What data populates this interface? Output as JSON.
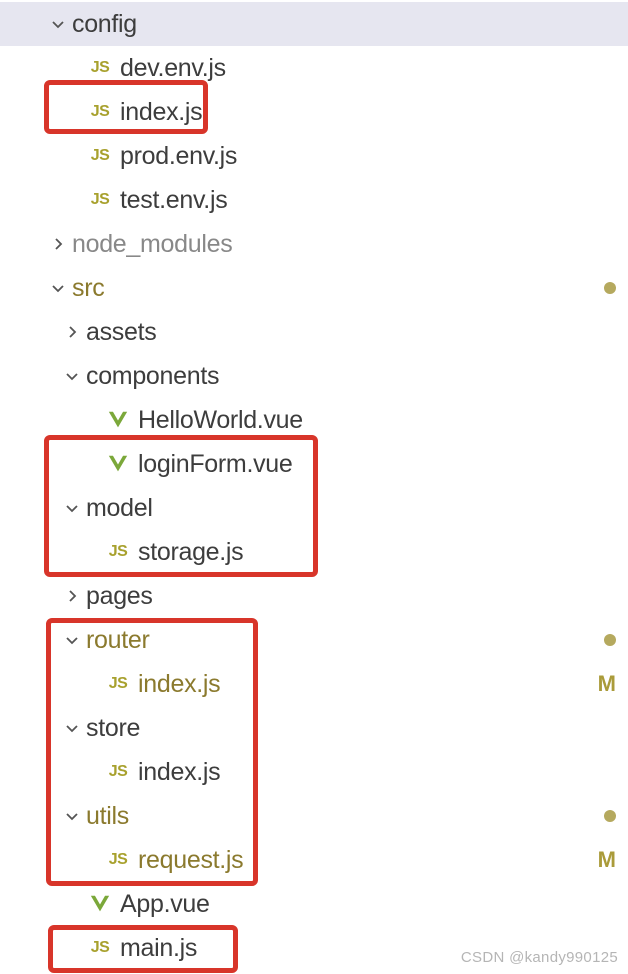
{
  "icons": {
    "js": "JS"
  },
  "tree": [
    {
      "indent": 0,
      "chevron": "down",
      "icon": null,
      "label": "config",
      "labelClass": "folder",
      "selected": true
    },
    {
      "indent": 1,
      "chevron": null,
      "icon": "js",
      "label": "dev.env.js",
      "labelClass": ""
    },
    {
      "indent": 1,
      "chevron": null,
      "icon": "js",
      "label": "index.js",
      "labelClass": ""
    },
    {
      "indent": 1,
      "chevron": null,
      "icon": "js",
      "label": "prod.env.js",
      "labelClass": ""
    },
    {
      "indent": 1,
      "chevron": null,
      "icon": "js",
      "label": "test.env.js",
      "labelClass": ""
    },
    {
      "indent": 0,
      "chevron": "right",
      "icon": null,
      "label": "node_modules",
      "labelClass": "dim"
    },
    {
      "indent": 0,
      "chevron": "down",
      "icon": null,
      "label": "src",
      "labelClass": "modified",
      "dot": true
    },
    {
      "indent": 1,
      "chevron": "right",
      "icon": null,
      "label": "assets",
      "labelClass": "folder"
    },
    {
      "indent": 1,
      "chevron": "down",
      "icon": null,
      "label": "components",
      "labelClass": "folder"
    },
    {
      "indent": 2,
      "chevron": null,
      "icon": "vue",
      "label": "HelloWorld.vue",
      "labelClass": ""
    },
    {
      "indent": 2,
      "chevron": null,
      "icon": "vue",
      "label": "loginForm.vue",
      "labelClass": ""
    },
    {
      "indent": 1,
      "chevron": "down",
      "icon": null,
      "label": "model",
      "labelClass": "folder"
    },
    {
      "indent": 2,
      "chevron": null,
      "icon": "js",
      "label": "storage.js",
      "labelClass": ""
    },
    {
      "indent": 1,
      "chevron": "right",
      "icon": null,
      "label": "pages",
      "labelClass": "folder"
    },
    {
      "indent": 1,
      "chevron": "down",
      "icon": null,
      "label": "router",
      "labelClass": "modified",
      "dot": true
    },
    {
      "indent": 2,
      "chevron": null,
      "icon": "js",
      "label": "index.js",
      "labelClass": "modified",
      "mBadge": true
    },
    {
      "indent": 1,
      "chevron": "down",
      "icon": null,
      "label": "store",
      "labelClass": "folder"
    },
    {
      "indent": 2,
      "chevron": null,
      "icon": "js",
      "label": "index.js",
      "labelClass": ""
    },
    {
      "indent": 1,
      "chevron": "down",
      "icon": null,
      "label": "utils",
      "labelClass": "modified",
      "dot": true
    },
    {
      "indent": 2,
      "chevron": null,
      "icon": "js",
      "label": "request.js",
      "labelClass": "modified",
      "mBadge": true
    },
    {
      "indent": 1,
      "chevron": null,
      "icon": "vue",
      "label": "App.vue",
      "labelClass": ""
    },
    {
      "indent": 1,
      "chevron": null,
      "icon": "js",
      "label": "main.js",
      "labelClass": ""
    }
  ],
  "watermark": "CSDN @kandy990125",
  "modifiedBadge": "M"
}
